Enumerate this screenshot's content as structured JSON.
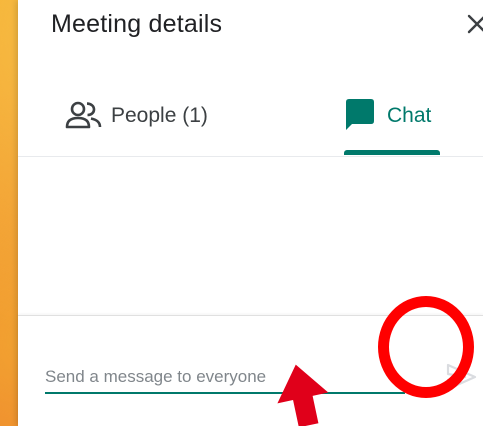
{
  "panel": {
    "title": "Meeting details",
    "close_icon": "close-icon"
  },
  "tabs": [
    {
      "label": "People (1)",
      "icon": "people-icon",
      "selected": false
    },
    {
      "label": "Chat",
      "icon": "chat-bubble-icon",
      "selected": true
    }
  ],
  "compose": {
    "placeholder": "Send a message to everyone",
    "value": "",
    "send_icon": "send-icon"
  },
  "colors": {
    "accent": "#00796b",
    "annotation": "#ff0000",
    "text_primary": "#202124",
    "text_secondary": "#3c4043",
    "placeholder": "#80868b"
  }
}
